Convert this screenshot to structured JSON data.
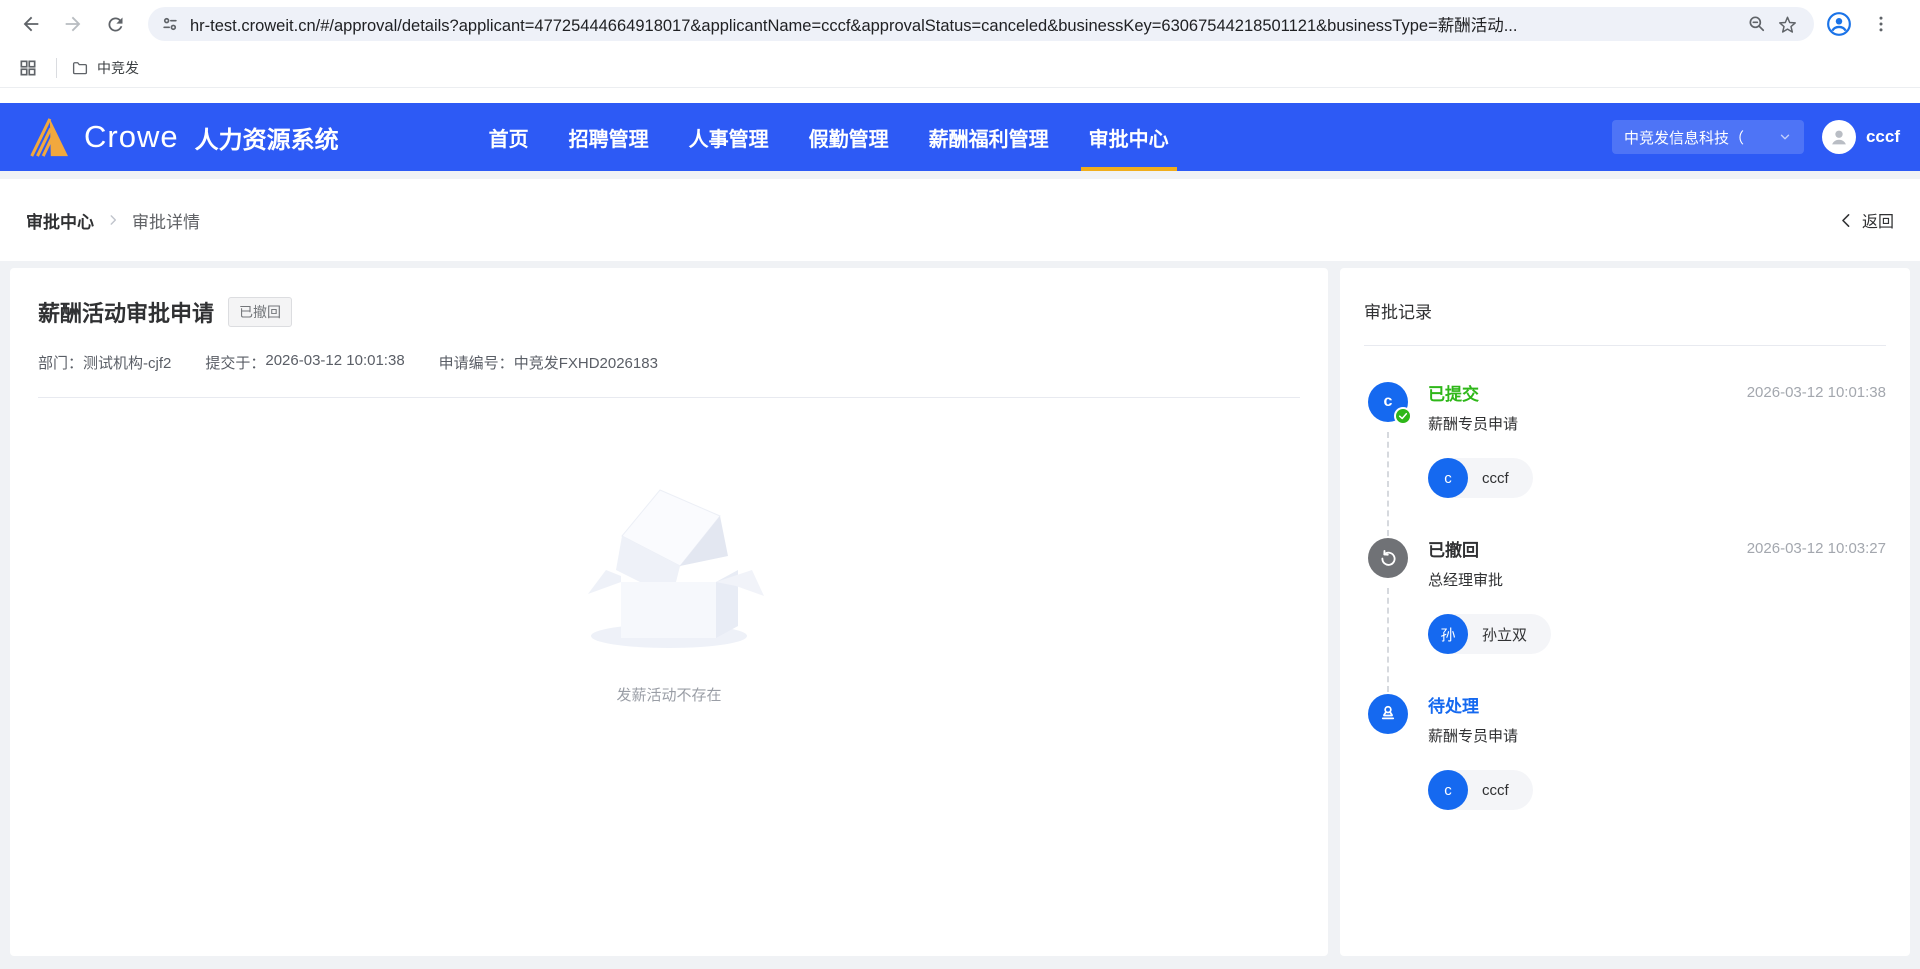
{
  "browser": {
    "url": "hr-test.croweit.cn/#/approval/details?applicant=47725444664918017&applicantName=cccf&approvalStatus=canceled&businessKey=63067544218501121&businessType=薪酬活动...",
    "bookmark_folder": "中竞发"
  },
  "header": {
    "brand": "Crowe",
    "product": "人力资源系统",
    "nav": [
      {
        "label": "首页"
      },
      {
        "label": "招聘管理"
      },
      {
        "label": "人事管理"
      },
      {
        "label": "假勤管理"
      },
      {
        "label": "薪酬福利管理"
      },
      {
        "label": "审批中心"
      }
    ],
    "org_selector": "中竞发信息科技（",
    "username": "cccf"
  },
  "breadcrumb": {
    "root": "审批中心",
    "current": "审批详情",
    "back_label": "返回"
  },
  "main": {
    "title": "薪酬活动审批申请",
    "status_badge": "已撤回",
    "meta": [
      {
        "label": "部门：",
        "value": "测试机构-cjf2"
      },
      {
        "label": "提交于：",
        "value": "2026-03-12 10:01:38"
      },
      {
        "label": "申请编号：",
        "value": "中竞发FXHD2026183"
      }
    ],
    "empty_text": "发薪活动不存在"
  },
  "approval_panel": {
    "title": "审批记录",
    "records": [
      {
        "status": "已提交",
        "node": "薪酬专员申请",
        "time": "2026-03-12 10:01:38",
        "actor_initial": "c",
        "assignee_initial": "c",
        "assignee_name": "cccf"
      },
      {
        "status": "已撤回",
        "node": "总经理审批",
        "time": "2026-03-12 10:03:27",
        "assignee_initial": "孙",
        "assignee_name": "孙立双"
      },
      {
        "status": "待处理",
        "node": "薪酬专员申请",
        "time": "",
        "assignee_initial": "c",
        "assignee_name": "cccf"
      }
    ]
  },
  "colors": {
    "header_blue": "#2d5af5",
    "accent_gold": "#f0ad1b",
    "primary_blue": "#1569f0",
    "success_green": "#2eb719",
    "withdrawn_gray": "#707276"
  }
}
